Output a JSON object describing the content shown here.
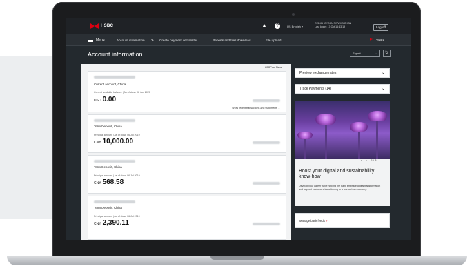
{
  "header": {
    "brand": "HSBC",
    "language": "US English",
    "language_chevron": "▾",
    "user_name": "REDIGHGYSSN SWWHBIOHSN",
    "last_login": "Last logon: 17 Oct 16:43:19",
    "logout_label": "Log off",
    "icons": {
      "bell": "bell-icon",
      "help": "help-icon"
    }
  },
  "nav": {
    "menu_label": "Menu",
    "items": [
      {
        "label": "Account information"
      },
      {
        "label": "Create payment or transfer"
      },
      {
        "label": "Reports and files download"
      },
      {
        "label": "File upload"
      }
    ],
    "tasks_label": "Tasks"
  },
  "page": {
    "title": "Account information",
    "export_label": "Export",
    "card_news": "HSBCnet News"
  },
  "accounts": [
    {
      "type": "Current account, China",
      "balance_label": "Current available balance | As of close 06 Jun 2021",
      "currency": "USD",
      "amount": "0.00",
      "recent_link": "Show recent transactions and statements"
    },
    {
      "type": "Term Deposit, China",
      "balance_label": "Principal amount | As of close 06 Jul 2019",
      "currency": "CNY",
      "amount": "10,000.00"
    },
    {
      "type": "Term Deposit, China",
      "balance_label": "Principal amount | As of close 06 Jul 2019",
      "currency": "CNY",
      "amount": "568.58"
    },
    {
      "type": "Term Deposit, China",
      "balance_label": "Principal amount | As of close 06 Jul 2019",
      "currency": "CNY",
      "amount": "2,390.11"
    }
  ],
  "sidebar": {
    "preview_rates": "Preview exchange rates",
    "track_payments": "Track Payments (14)",
    "promo_pager": "1 / 3",
    "promo_title": "Boost your digital and sustainability know-how",
    "promo_body": "Develop your career while helping the bank embrace digital transformation and support customers transitioning to a low-carbon economy.",
    "manage_feeds": "Manage bank feeds",
    "manage_arrow": "›"
  },
  "colors": {
    "brand_red": "#db0011",
    "header_dark": "#1f2226",
    "content_bg": "#23292e"
  }
}
